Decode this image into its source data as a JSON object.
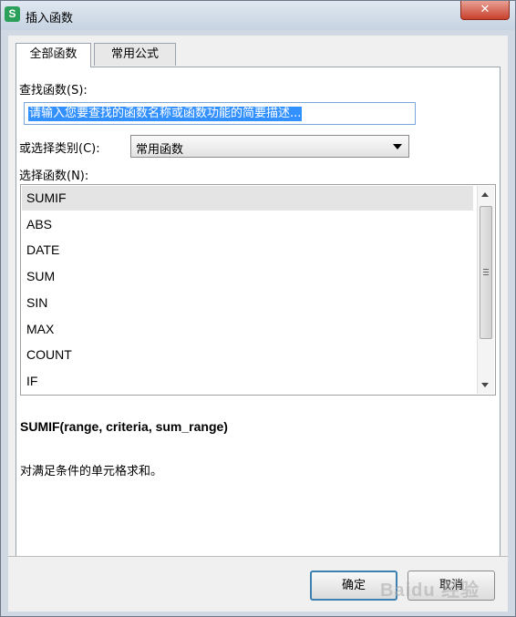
{
  "window": {
    "title": "插入函数",
    "close_symbol": "✕",
    "app_icon_glyph": "S",
    "accent": "#3390ff"
  },
  "tabs": [
    {
      "label": "全部函数",
      "active": true
    },
    {
      "label": "常用公式",
      "active": false
    }
  ],
  "search": {
    "label": "查找函数(S):",
    "value": "请输入您要查找的函数名称或函数功能的简要描述..."
  },
  "category": {
    "label": "或选择类别(C):",
    "value": "常用函数"
  },
  "function_list": {
    "label": "选择函数(N):",
    "items": [
      "SUMIF",
      "ABS",
      "DATE",
      "SUM",
      "SIN",
      "MAX",
      "COUNT",
      "IF"
    ],
    "selected": "SUMIF"
  },
  "details": {
    "signature": "SUMIF(range, criteria, sum_range)",
    "description": "对满足条件的单元格求和。"
  },
  "buttons": {
    "ok": "确定",
    "cancel": "取消"
  },
  "watermark": "Baidu 经验"
}
